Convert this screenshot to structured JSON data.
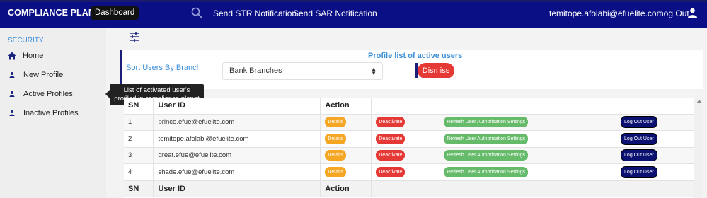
{
  "header": {
    "brand": "COMPLIANCE PLANET",
    "dashboard_label": "Dashboard",
    "search_icon": "search-icon",
    "nav": [
      "Send STR Notification",
      "Send SAR Notification"
    ],
    "user_email": "temitope.afolabi@efuelite.com",
    "logout_label": "Log Out",
    "user_icon": "person-icon",
    "bg_color": "#0a0f86"
  },
  "sidebar": {
    "section": "SECURITY",
    "items": [
      {
        "label": "Home",
        "icon": "home-icon"
      },
      {
        "label": "New Profile",
        "icon": "person-icon"
      },
      {
        "label": "Active Profiles",
        "icon": "person-icon"
      },
      {
        "label": "Inactive Profiles",
        "icon": "person-icon"
      }
    ]
  },
  "tooltip": {
    "line1": "List of activated user's",
    "line2": "profiled in compliance planet"
  },
  "panel": {
    "title": "Profile list of active users",
    "sort_label": "Sort Users By Branch",
    "select_value": "Bank Branches",
    "dismiss_label": "Dismiss"
  },
  "table": {
    "headers": [
      "SN",
      "User ID",
      "Action",
      "",
      "",
      ""
    ],
    "footer": [
      "SN",
      "User ID",
      "Action"
    ],
    "rows": [
      {
        "sn": "1",
        "user": "prince.efue@efuelite.com"
      },
      {
        "sn": "2",
        "user": "temitope.afolabi@efuelite.com"
      },
      {
        "sn": "3",
        "user": "great.efue@efuelite.com"
      },
      {
        "sn": "4",
        "user": "shade.efue@efuelite.com"
      }
    ],
    "actions": {
      "details": "Details",
      "deactivate": "Deactivate",
      "refresh": "Refresh User Authorisation Settings",
      "logout": "Log Out User"
    }
  }
}
